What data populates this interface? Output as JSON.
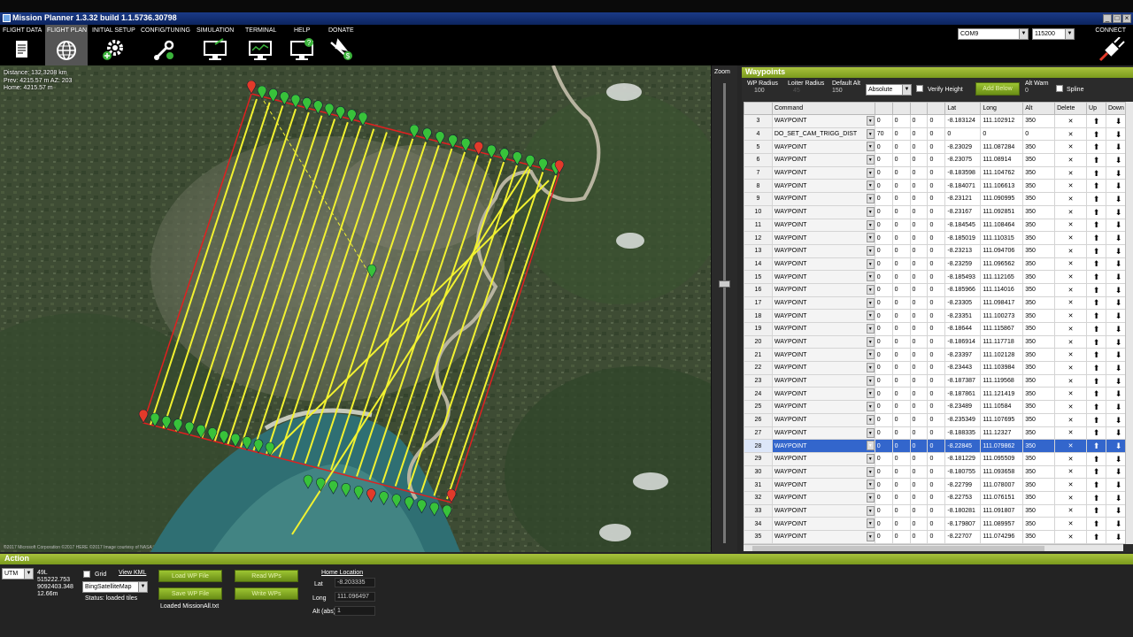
{
  "window": {
    "title": "Mission Planner 1.3.32 build 1.1.5736.30798",
    "controls": [
      "_",
      "□",
      "×"
    ]
  },
  "menu": {
    "items": [
      {
        "label": "FLIGHT DATA",
        "icon": "flight-data-icon"
      },
      {
        "label": "FLIGHT PLAN",
        "icon": "globe-icon",
        "active": true
      },
      {
        "label": "INITIAL SETUP",
        "icon": "setup-gear-icon"
      },
      {
        "label": "CONFIG/TUNING",
        "icon": "wrench-icon"
      },
      {
        "label": "SIMULATION",
        "icon": "simulation-monitor-icon"
      },
      {
        "label": "TERMINAL",
        "icon": "terminal-monitor-icon"
      },
      {
        "label": "HELP",
        "icon": "help-monitor-icon"
      },
      {
        "label": "DONATE",
        "icon": "donate-plane-icon"
      }
    ],
    "com_port": "COM9",
    "baud_rate": "115200",
    "connect_label": "CONNECT"
  },
  "map": {
    "distance": "Distance: 132.3208 km",
    "prev": "Prev: 4215.57 m AZ: 203",
    "home": "Home: 4215.57 m",
    "copyright": "©2017 Microsoft Corporation  ©2017 HERE  ©2017 Image courtesy of NASA"
  },
  "zoom": {
    "label": "Zoom"
  },
  "waypoints": {
    "title": "Waypoints",
    "wp_radius_label": "WP Radius",
    "wp_radius": "100",
    "loiter_radius_label": "Loiter Radius",
    "loiter_radius": "45",
    "default_alt_label": "Default Alt",
    "default_alt": "150",
    "alt_mode": "Absolute",
    "verify_height_label": "Verify Height",
    "add_below_label": "Add Below",
    "alt_warn_label": "Alt Warn",
    "alt_warn": "0",
    "spline_label": "Spline",
    "columns": [
      "",
      "Command",
      "",
      "",
      "",
      "",
      "Lat",
      "Long",
      "Alt",
      "Delete",
      "Up",
      "Down"
    ],
    "selected_row": "28",
    "rows": [
      [
        "3",
        "WAYPOINT",
        "0",
        "0",
        "0",
        "0",
        "-8.183124",
        "111.102912",
        "350"
      ],
      [
        "4",
        "DO_SET_CAM_TRIGG_DIST",
        "70",
        "0",
        "0",
        "0",
        "0",
        "0",
        "0"
      ],
      [
        "5",
        "WAYPOINT",
        "0",
        "0",
        "0",
        "0",
        "-8.23029",
        "111.087284",
        "350"
      ],
      [
        "6",
        "WAYPOINT",
        "0",
        "0",
        "0",
        "0",
        "-8.23075",
        "111.08914",
        "350"
      ],
      [
        "7",
        "WAYPOINT",
        "0",
        "0",
        "0",
        "0",
        "-8.183598",
        "111.104762",
        "350"
      ],
      [
        "8",
        "WAYPOINT",
        "0",
        "0",
        "0",
        "0",
        "-8.184071",
        "111.106613",
        "350"
      ],
      [
        "9",
        "WAYPOINT",
        "0",
        "0",
        "0",
        "0",
        "-8.23121",
        "111.090995",
        "350"
      ],
      [
        "10",
        "WAYPOINT",
        "0",
        "0",
        "0",
        "0",
        "-8.23167",
        "111.092851",
        "350"
      ],
      [
        "11",
        "WAYPOINT",
        "0",
        "0",
        "0",
        "0",
        "-8.184545",
        "111.108464",
        "350"
      ],
      [
        "12",
        "WAYPOINT",
        "0",
        "0",
        "0",
        "0",
        "-8.185019",
        "111.110315",
        "350"
      ],
      [
        "13",
        "WAYPOINT",
        "0",
        "0",
        "0",
        "0",
        "-8.23213",
        "111.094706",
        "350"
      ],
      [
        "14",
        "WAYPOINT",
        "0",
        "0",
        "0",
        "0",
        "-8.23259",
        "111.096562",
        "350"
      ],
      [
        "15",
        "WAYPOINT",
        "0",
        "0",
        "0",
        "0",
        "-8.185493",
        "111.112165",
        "350"
      ],
      [
        "16",
        "WAYPOINT",
        "0",
        "0",
        "0",
        "0",
        "-8.185966",
        "111.114016",
        "350"
      ],
      [
        "17",
        "WAYPOINT",
        "0",
        "0",
        "0",
        "0",
        "-8.23305",
        "111.098417",
        "350"
      ],
      [
        "18",
        "WAYPOINT",
        "0",
        "0",
        "0",
        "0",
        "-8.23351",
        "111.100273",
        "350"
      ],
      [
        "19",
        "WAYPOINT",
        "0",
        "0",
        "0",
        "0",
        "-8.18644",
        "111.115867",
        "350"
      ],
      [
        "20",
        "WAYPOINT",
        "0",
        "0",
        "0",
        "0",
        "-8.186914",
        "111.117718",
        "350"
      ],
      [
        "21",
        "WAYPOINT",
        "0",
        "0",
        "0",
        "0",
        "-8.23397",
        "111.102128",
        "350"
      ],
      [
        "22",
        "WAYPOINT",
        "0",
        "0",
        "0",
        "0",
        "-8.23443",
        "111.103984",
        "350"
      ],
      [
        "23",
        "WAYPOINT",
        "0",
        "0",
        "0",
        "0",
        "-8.187387",
        "111.119568",
        "350"
      ],
      [
        "24",
        "WAYPOINT",
        "0",
        "0",
        "0",
        "0",
        "-8.187861",
        "111.121419",
        "350"
      ],
      [
        "25",
        "WAYPOINT",
        "0",
        "0",
        "0",
        "0",
        "-8.23489",
        "111.10584",
        "350"
      ],
      [
        "26",
        "WAYPOINT",
        "0",
        "0",
        "0",
        "0",
        "-8.235349",
        "111.107695",
        "350"
      ],
      [
        "27",
        "WAYPOINT",
        "0",
        "0",
        "0",
        "0",
        "-8.188335",
        "111.12327",
        "350"
      ],
      [
        "28",
        "WAYPOINT",
        "0",
        "0",
        "0",
        "0",
        "-8.22845",
        "111.079862",
        "350"
      ],
      [
        "29",
        "WAYPOINT",
        "0",
        "0",
        "0",
        "0",
        "-8.181229",
        "111.095509",
        "350"
      ],
      [
        "30",
        "WAYPOINT",
        "0",
        "0",
        "0",
        "0",
        "-8.180755",
        "111.093658",
        "350"
      ],
      [
        "31",
        "WAYPOINT",
        "0",
        "0",
        "0",
        "0",
        "-8.22799",
        "111.078007",
        "350"
      ],
      [
        "32",
        "WAYPOINT",
        "0",
        "0",
        "0",
        "0",
        "-8.22753",
        "111.076151",
        "350"
      ],
      [
        "33",
        "WAYPOINT",
        "0",
        "0",
        "0",
        "0",
        "-8.180281",
        "111.091807",
        "350"
      ],
      [
        "34",
        "WAYPOINT",
        "0",
        "0",
        "0",
        "0",
        "-8.179807",
        "111.089957",
        "350"
      ],
      [
        "35",
        "WAYPOINT",
        "0",
        "0",
        "0",
        "0",
        "-8.22707",
        "111.074296",
        "350"
      ]
    ]
  },
  "action": {
    "title": "Action",
    "coord_system": "UTM",
    "utm_zone": "49L",
    "utm_easting": "515222.753",
    "utm_northing": "9092403.348",
    "utm_alt": "12.66m",
    "grid_label": "Grid",
    "view_kml_label": "View KML",
    "map_provider": "BingSatelliteMap",
    "status": "Status: loaded tiles",
    "load_wp_label": "Load WP File",
    "save_wp_label": "Save WP File",
    "read_wps_label": "Read WPs",
    "write_wps_label": "Write WPs",
    "loaded_file": "Loaded MissionAll.txt",
    "home_location_label": "Home Location",
    "lat_label": "Lat",
    "lat_value": "-8.203335",
    "long_label": "Long",
    "long_value": "111.096497",
    "alt_label": "Alt (abs)",
    "alt_value": "1"
  },
  "colors": {
    "accent_green": "#8fb02a",
    "survey_line": "#f2f230",
    "boundary": "#e02020",
    "marker_green": "#38c23a",
    "marker_red": "#e23a2a"
  }
}
